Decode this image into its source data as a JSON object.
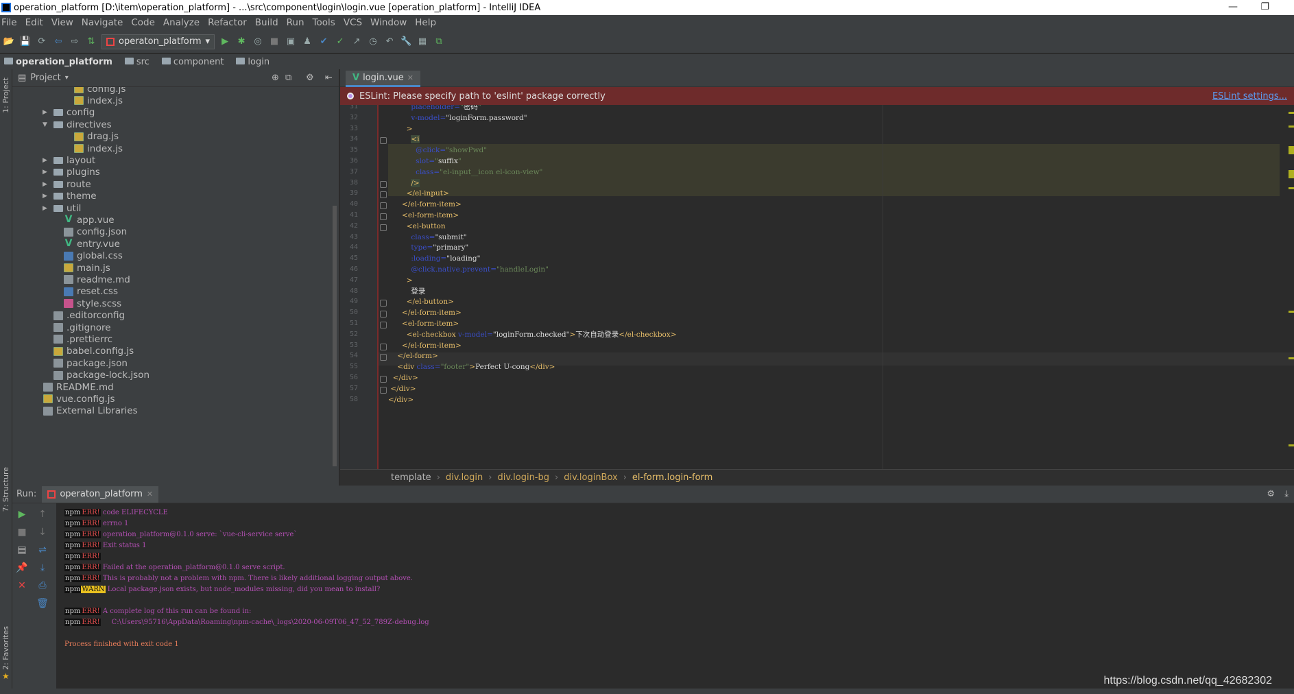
{
  "window": {
    "title": "operation_platform [D:\\item\\operation_platform] - ...\\src\\component\\login\\login.vue [operation_platform] - IntelliJ IDEA",
    "minimize": "—",
    "restore": "❐"
  },
  "menu": [
    "File",
    "Edit",
    "View",
    "Navigate",
    "Code",
    "Analyze",
    "Refactor",
    "Build",
    "Run",
    "Tools",
    "VCS",
    "Window",
    "Help"
  ],
  "run_config": "operaton_platform",
  "breadcrumb_nav": [
    "operation_platform",
    "src",
    "component",
    "login"
  ],
  "side_tabs": {
    "project": "1: Project",
    "structure": "7: Structure",
    "favorites": "2: Favorites"
  },
  "project_panel": {
    "title": "Project",
    "tree": [
      {
        "label": "config.js",
        "indent": 4,
        "icon": "js"
      },
      {
        "label": "index.js",
        "indent": 4,
        "icon": "js"
      },
      {
        "label": "config",
        "indent": 2,
        "icon": "folder",
        "arrow": "▶"
      },
      {
        "label": "directives",
        "indent": 2,
        "icon": "folder",
        "arrow": "▼"
      },
      {
        "label": "drag.js",
        "indent": 4,
        "icon": "js"
      },
      {
        "label": "index.js",
        "indent": 4,
        "icon": "js"
      },
      {
        "label": "layout",
        "indent": 2,
        "icon": "folder",
        "arrow": "▶"
      },
      {
        "label": "plugins",
        "indent": 2,
        "icon": "folder",
        "arrow": "▶"
      },
      {
        "label": "route",
        "indent": 2,
        "icon": "folder",
        "arrow": "▶"
      },
      {
        "label": "theme",
        "indent": 2,
        "icon": "folder",
        "arrow": "▶"
      },
      {
        "label": "util",
        "indent": 2,
        "icon": "folder",
        "arrow": "▶"
      },
      {
        "label": "app.vue",
        "indent": 3,
        "icon": "vue"
      },
      {
        "label": "config.json",
        "indent": 3,
        "icon": "file"
      },
      {
        "label": "entry.vue",
        "indent": 3,
        "icon": "vue"
      },
      {
        "label": "global.css",
        "indent": 3,
        "icon": "css"
      },
      {
        "label": "main.js",
        "indent": 3,
        "icon": "js"
      },
      {
        "label": "readme.md",
        "indent": 3,
        "icon": "file"
      },
      {
        "label": "reset.css",
        "indent": 3,
        "icon": "css"
      },
      {
        "label": "style.scss",
        "indent": 3,
        "icon": "scss"
      },
      {
        "label": ".editorconfig",
        "indent": 2,
        "icon": "file"
      },
      {
        "label": ".gitignore",
        "indent": 2,
        "icon": "file"
      },
      {
        "label": ".prettierrc",
        "indent": 2,
        "icon": "file"
      },
      {
        "label": "babel.config.js",
        "indent": 2,
        "icon": "js"
      },
      {
        "label": "package.json",
        "indent": 2,
        "icon": "file"
      },
      {
        "label": "package-lock.json",
        "indent": 2,
        "icon": "file"
      },
      {
        "label": "README.md",
        "indent": 1,
        "icon": "file"
      },
      {
        "label": "vue.config.js",
        "indent": 1,
        "icon": "js"
      },
      {
        "label": "External Libraries",
        "indent": 1,
        "icon": "file"
      }
    ]
  },
  "editor_tab": "login.vue",
  "eslint_banner": {
    "message": "ESLint: Please specify path to 'eslint' package correctly",
    "link": "ESLint settings..."
  },
  "code_lines": [
    {
      "n": "31",
      "html": "          <span class='a'>placeholder=</span><span class='s'>\"</span><span class='w'>密码</span><span class='s'>\"</span>"
    },
    {
      "n": "32",
      "html": "          <span class='a'>v-model=</span><span class='w'>\"loginForm.password\"</span>"
    },
    {
      "n": "33",
      "html": "        <span class='t'>&gt;</span>"
    },
    {
      "n": "34",
      "html": "          <span class='t tagbg'>&lt;i</span>"
    },
    {
      "n": "35",
      "html": "            <span class='a'>@click=</span><span class='s'>\"showPwd\"</span>"
    },
    {
      "n": "36",
      "html": "            <span class='a'>slot=</span><span class='s'>\"</span><span class='w'>suffix</span><span class='s'>\"</span>"
    },
    {
      "n": "37",
      "html": "            <span class='a'>class=</span><span class='s'>\"el-input__icon el-icon-view\"</span>"
    },
    {
      "n": "38",
      "html": "          <span class='t tagbg'>/&gt;</span>"
    },
    {
      "n": "39",
      "html": "        <span class='t'>&lt;/el-input&gt;</span>"
    },
    {
      "n": "40",
      "html": "      <span class='t'>&lt;/el-form-item&gt;</span>"
    },
    {
      "n": "41",
      "html": "      <span class='t'>&lt;el-form-item&gt;</span>"
    },
    {
      "n": "42",
      "html": "        <span class='t'>&lt;el-button</span>"
    },
    {
      "n": "43",
      "html": "          <span class='a'>class=</span><span class='w'>\"submit\"</span>"
    },
    {
      "n": "44",
      "html": "          <span class='a'>type=</span><span class='w'>\"primary\"</span>"
    },
    {
      "n": "45",
      "html": "          <span class='a'>:loading=</span><span class='w'>\"loading\"</span>"
    },
    {
      "n": "46",
      "html": "          <span class='a'>@click.native.prevent=</span><span class='s'>\"handleLogin\"</span>"
    },
    {
      "n": "47",
      "html": "        <span class='t'>&gt;</span>"
    },
    {
      "n": "48",
      "html": "          <span class='w'>登录</span>"
    },
    {
      "n": "49",
      "html": "        <span class='t'>&lt;/el-button&gt;</span>"
    },
    {
      "n": "50",
      "html": "      <span class='t'>&lt;/el-form-item&gt;</span>"
    },
    {
      "n": "51",
      "html": "      <span class='t'>&lt;el-form-item&gt;</span>"
    },
    {
      "n": "52",
      "html": "        <span class='t'>&lt;el-checkbox</span> <span class='a'>v-model=</span><span class='w'>\"loginForm.checked\"</span><span class='t'>&gt;</span><span class='w'>下次自动登录</span><span class='t'>&lt;/el-checkbox&gt;</span>"
    },
    {
      "n": "53",
      "html": "      <span class='t'>&lt;/el-form-item&gt;</span>"
    },
    {
      "n": "54",
      "html": "    <span class='t'>&lt;/el-form&gt;</span>"
    },
    {
      "n": "55",
      "html": "    <span class='t'>&lt;div</span> <span class='a'>class=</span><span class='s'>\"footer\"</span><span class='t'>&gt;</span><span class='w'>Perfect U-cong</span><span class='t'>&lt;/div&gt;</span>"
    },
    {
      "n": "56",
      "html": "  <span class='t'>&lt;/div&gt;</span>"
    },
    {
      "n": "57",
      "html": " <span class='t'>&lt;/div&gt;</span>"
    },
    {
      "n": "58",
      "html": "<span class='t'>&lt;/div&gt;</span>"
    }
  ],
  "code_breadcrumb": [
    "template",
    "div.login",
    "div.login-bg",
    "div.loginBox",
    "el-form.login-form"
  ],
  "run_panel": {
    "label": "Run:",
    "tab": "operaton_platform"
  },
  "console": [
    {
      "type": "err",
      "text": "code ELIFECYCLE"
    },
    {
      "type": "err",
      "text": "errno 1"
    },
    {
      "type": "err",
      "text": "operation_platform@0.1.0 serve: `vue-cli-service serve`"
    },
    {
      "type": "err",
      "text": "Exit status 1"
    },
    {
      "type": "err",
      "text": ""
    },
    {
      "type": "err",
      "text": "Failed at the operation_platform@0.1.0 serve script."
    },
    {
      "type": "err",
      "text": "This is probably not a problem with npm. There is likely additional logging output above."
    },
    {
      "type": "warn",
      "text": "Local package.json exists, but node_modules missing, did you mean to install?"
    },
    {
      "type": "blank",
      "text": ""
    },
    {
      "type": "err",
      "text": "A complete log of this run can be found in:"
    },
    {
      "type": "err",
      "text": "    C:\\Users\\95716\\AppData\\Roaming\\npm-cache\\_logs\\2020-06-09T06_47_52_789Z-debug.log"
    },
    {
      "type": "blank",
      "text": ""
    },
    {
      "type": "exit",
      "text": "Process finished with exit code 1"
    }
  ],
  "console_labels": {
    "npm": "npm",
    "err": "ERR!",
    "warn": "WARN"
  },
  "watermark": "https://blog.csdn.net/qq_42682302",
  "colors": {
    "accent": "#4a88c7",
    "error_banner": "#6e2b2b",
    "tag": "#e8bf6a",
    "attr": "#3a4ec8",
    "string": "#6a8759",
    "console_msg": "#b44fb4"
  }
}
